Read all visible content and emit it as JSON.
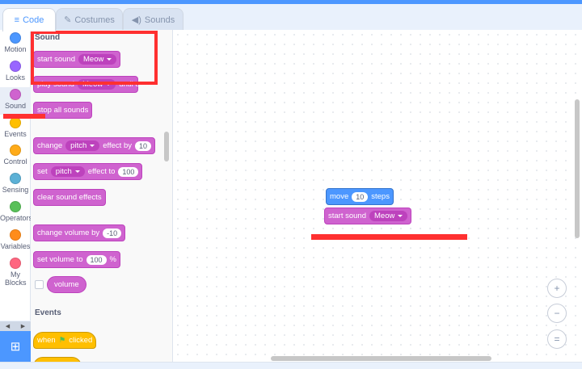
{
  "tabs": [
    {
      "label": "Code",
      "icon": "code-icon"
    },
    {
      "label": "Costumes",
      "icon": "brush-icon"
    },
    {
      "label": "Sounds",
      "icon": "speaker-icon"
    }
  ],
  "categories": [
    {
      "label": "Motion",
      "color": "#4c97ff"
    },
    {
      "label": "Looks",
      "color": "#9966ff"
    },
    {
      "label": "Sound",
      "color": "#cf63cf"
    },
    {
      "label": "Events",
      "color": "#ffbf00"
    },
    {
      "label": "Control",
      "color": "#ffab19"
    },
    {
      "label": "Sensing",
      "color": "#5cb1d6"
    },
    {
      "label": "Operators",
      "color": "#59c059"
    },
    {
      "label": "Variables",
      "color": "#ff8c1a"
    },
    {
      "label": "My Blocks",
      "color": "#ff6680"
    }
  ],
  "palette": {
    "sound_heading": "Sound",
    "start_sound": {
      "text": "start sound",
      "sound": "Meow"
    },
    "play_until_done": {
      "text": "play sound",
      "sound": "Meow",
      "suffix": "until done"
    },
    "stop_all": "stop all sounds",
    "change_effect": {
      "text": "change",
      "effect": "pitch",
      "mid": "effect by",
      "value": "10"
    },
    "set_effect": {
      "text": "set",
      "effect": "pitch",
      "mid": "effect to",
      "value": "100"
    },
    "clear_effects": "clear sound effects",
    "change_volume": {
      "text": "change volume by",
      "value": "-10"
    },
    "set_volume": {
      "text": "set volume to",
      "value": "100",
      "suffix": "%"
    },
    "volume_reporter": "volume",
    "events_heading": "Events",
    "when_flag": {
      "text": "when",
      "suffix": "clicked"
    }
  },
  "script": {
    "move": {
      "text": "move",
      "value": "10",
      "suffix": "steps"
    },
    "start_sound": {
      "text": "start sound",
      "sound": "Meow"
    }
  },
  "zoom": {
    "in": "+",
    "out": "−",
    "reset": "="
  },
  "colors": {
    "sound": "#cf63cf",
    "motion": "#4c97ff",
    "events": "#ffbf00",
    "annotation": "#ff3030"
  }
}
